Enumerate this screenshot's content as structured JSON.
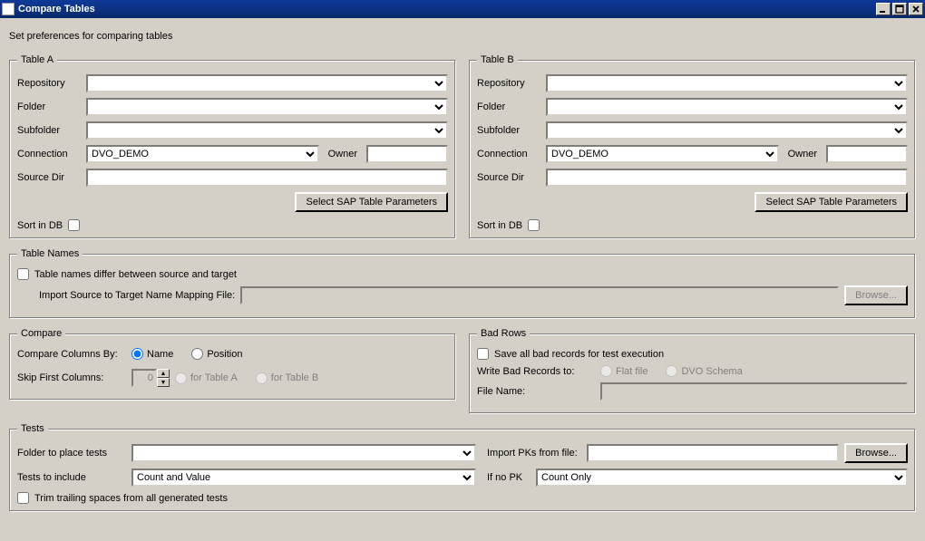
{
  "window": {
    "title": "Compare Tables"
  },
  "instructions": "Set preferences for comparing tables",
  "tableA": {
    "legend": "Table A",
    "repository_label": "Repository",
    "repository_value": "",
    "folder_label": "Folder",
    "folder_value": "",
    "subfolder_label": "Subfolder",
    "subfolder_value": "",
    "connection_label": "Connection",
    "connection_value": "DVO_DEMO",
    "owner_label": "Owner",
    "owner_value": "",
    "sourcedir_label": "Source Dir",
    "sourcedir_value": "",
    "sap_button": "Select SAP Table Parameters",
    "sortdb_label": "Sort in DB",
    "sortdb_checked": false
  },
  "tableB": {
    "legend": "Table B",
    "repository_label": "Repository",
    "repository_value": "",
    "folder_label": "Folder",
    "folder_value": "",
    "subfolder_label": "Subfolder",
    "subfolder_value": "",
    "connection_label": "Connection",
    "connection_value": "DVO_DEMO",
    "owner_label": "Owner",
    "owner_value": "",
    "sourcedir_label": "Source Dir",
    "sourcedir_value": "",
    "sap_button": "Select SAP Table Parameters",
    "sortdb_label": "Sort in DB",
    "sortdb_checked": false
  },
  "tableNames": {
    "legend": "Table Names",
    "differ_label": "Table names differ between source and target",
    "differ_checked": false,
    "mapping_label": "Import Source to Target Name Mapping File:",
    "mapping_value": "",
    "browse_label": "Browse..."
  },
  "compare": {
    "legend": "Compare",
    "compare_by_label": "Compare Columns By:",
    "option_name": "Name",
    "option_position": "Position",
    "compare_by_selected": "name",
    "skip_label": "Skip First Columns:",
    "skip_value": "0",
    "skip_tableA": "for Table A",
    "skip_tableB": "for Table B"
  },
  "badRows": {
    "legend": "Bad Rows",
    "save_label": "Save all bad records for test execution",
    "save_checked": false,
    "write_label": "Write Bad Records to:",
    "option_flat": "Flat file",
    "option_schema": "DVO Schema",
    "filename_label": "File Name:",
    "filename_value": ""
  },
  "tests": {
    "legend": "Tests",
    "folder_label": "Folder to place tests",
    "folder_value": "",
    "import_pks_label": "Import PKs from file:",
    "import_pks_value": "",
    "browse_label": "Browse...",
    "include_label": "Tests to include",
    "include_value": "Count and Value",
    "ifnopk_label": "If no PK",
    "ifnopk_value": "Count Only",
    "trim_label": "Trim trailing spaces from all generated tests",
    "trim_checked": false
  }
}
